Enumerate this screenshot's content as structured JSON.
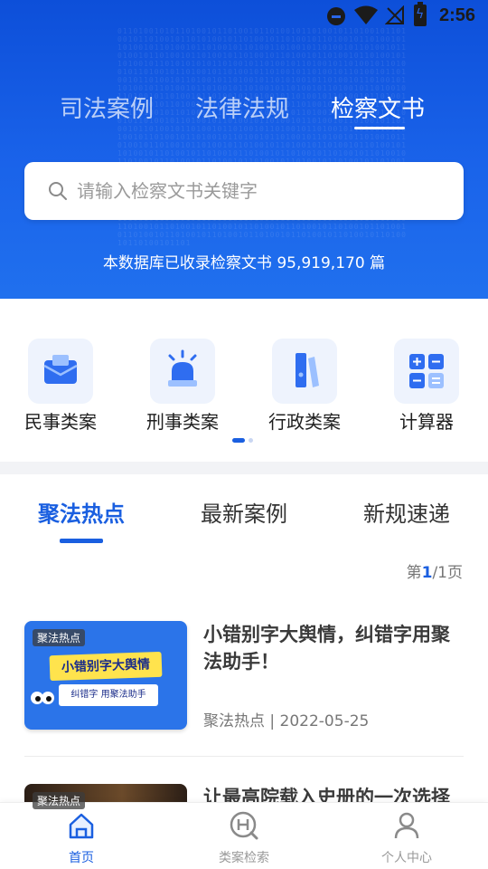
{
  "status_bar": {
    "time": "2:56"
  },
  "hero": {
    "tabs": [
      {
        "label": "司法案例"
      },
      {
        "label": "法律法规"
      },
      {
        "label": "检察文书"
      }
    ],
    "active_tab": "检察文书",
    "search": {
      "placeholder": "请输入检察文书关键字",
      "value": ""
    },
    "db_count": "本数据库已收录检察文书 95,919,170 篇"
  },
  "categories": [
    {
      "label": "民事类案",
      "icon": "envelope-icon"
    },
    {
      "label": "刑事类案",
      "icon": "siren-icon"
    },
    {
      "label": "行政类案",
      "icon": "binder-icon"
    },
    {
      "label": "计算器",
      "icon": "calculator-icon"
    }
  ],
  "news_tabs": [
    {
      "label": "聚法热点"
    },
    {
      "label": "最新案例"
    },
    {
      "label": "新规速递"
    }
  ],
  "active_news_tab": "聚法热点",
  "pager": {
    "prefix": "第",
    "current": "1",
    "suffix": "/1页"
  },
  "articles": [
    {
      "badge": "聚法热点",
      "thumb_title": "小错别字大舆情",
      "thumb_subtitle": "纠错字 用聚法助手",
      "title": "小错别字大舆情，纠错字用聚法助手！",
      "meta": "聚法热点 | 2022-05-25"
    },
    {
      "badge": "聚法热点",
      "title": "让最高院载入史册的一次选择"
    }
  ],
  "bottom_nav": [
    {
      "label": "首页",
      "icon": "home-icon",
      "active": true
    },
    {
      "label": "类案检索",
      "icon": "case-search-icon",
      "active": false
    },
    {
      "label": "个人中心",
      "icon": "user-icon",
      "active": false
    }
  ],
  "colors": {
    "primary": "#1a5fe0",
    "hero": "#1a63ea",
    "text": "#1e1e1e",
    "muted": "#777777"
  }
}
